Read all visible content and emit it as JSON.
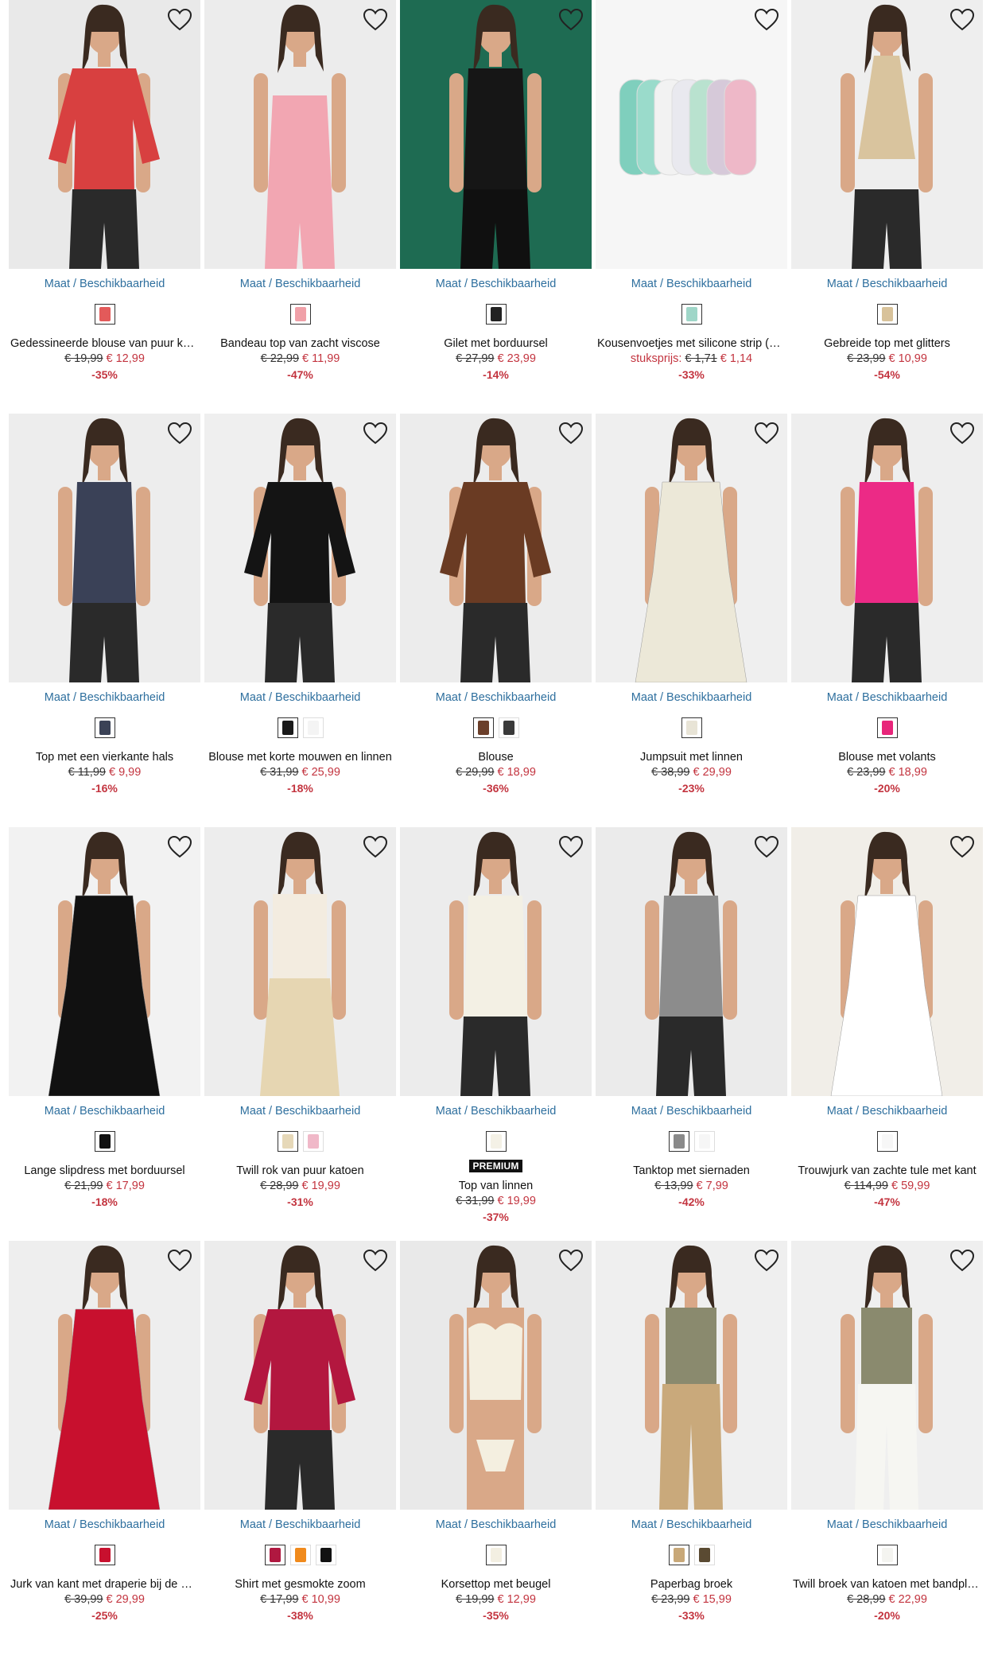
{
  "availability_label": "Maat / Beschikbaarheid",
  "wishlist_icon": "heart-outline-icon",
  "colors": {
    "price": "#c3343f",
    "link": "#2e6f9e"
  },
  "products": [
    {
      "title": "Gedessineerde blouse van puur kat…",
      "old_price": "€ 19,99",
      "new_price": "€ 12,99",
      "discount": "-35%",
      "swatches": [
        "#e35a5a"
      ],
      "image_bg": "#e9e9e9",
      "garment": "#d84040",
      "art": "blouse"
    },
    {
      "title": "Bandeau top van zacht viscose",
      "old_price": "€ 22,99",
      "new_price": "€ 11,99",
      "discount": "-47%",
      "swatches": [
        "#f0a0a8"
      ],
      "image_bg": "#ececec",
      "garment": "#f2a6b2",
      "art": "bandeau"
    },
    {
      "title": "Gilet met borduursel",
      "old_price": "€ 27,99",
      "new_price": "€ 23,99",
      "discount": "-14%",
      "swatches": [
        "#222222"
      ],
      "image_bg": "#1e6b52",
      "garment": "#161616",
      "art": "vest"
    },
    {
      "title": "Kousenvoetjes met silicone strip (7 …",
      "unit_label": "stuksprijs:",
      "old_price": "€ 1,71",
      "new_price": "€ 1,14",
      "discount": "-33%",
      "swatches": [
        "#9fd6c8"
      ],
      "image_bg": "#f6f6f6",
      "garment": "#7fcfbd",
      "art": "socks"
    },
    {
      "title": "Gebreide top met glitters",
      "old_price": "€ 23,99",
      "new_price": "€ 10,99",
      "discount": "-54%",
      "swatches": [
        "#d8c29a"
      ],
      "image_bg": "#eeeeee",
      "garment": "#d9c49e",
      "art": "halter"
    },
    {
      "title": "Top met een vierkante hals",
      "old_price": "€ 11,99",
      "new_price": "€ 9,99",
      "discount": "-16%",
      "swatches": [
        "#3b4256"
      ],
      "image_bg": "#ededed",
      "garment": "#3a4157",
      "art": "tank"
    },
    {
      "title": "Blouse met korte mouwen en linnen",
      "old_price": "€ 31,99",
      "new_price": "€ 25,99",
      "discount": "-18%",
      "swatches": [
        "#1a1a1a",
        "#f4f4f4"
      ],
      "image_bg": "#efefef",
      "garment": "#141414",
      "art": "blouse"
    },
    {
      "title": "Blouse",
      "old_price": "€ 29,99",
      "new_price": "€ 18,99",
      "discount": "-36%",
      "swatches": [
        "#6b3f2a",
        "#3a3a3a"
      ],
      "image_bg": "#ececec",
      "garment": "#6a3b23",
      "art": "blouse"
    },
    {
      "title": "Jumpsuit met linnen",
      "old_price": "€ 38,99",
      "new_price": "€ 29,99",
      "discount": "-23%",
      "swatches": [
        "#e8e4d6"
      ],
      "image_bg": "#efefef",
      "garment": "#ece8d8",
      "art": "dress"
    },
    {
      "title": "Blouse met volants",
      "old_price": "€ 23,99",
      "new_price": "€ 18,99",
      "discount": "-20%",
      "swatches": [
        "#e8257a"
      ],
      "image_bg": "#eeeeee",
      "garment": "#ec2a86",
      "art": "tank"
    },
    {
      "title": "Lange slipdress met borduursel",
      "old_price": "€ 21,99",
      "new_price": "€ 17,99",
      "discount": "-18%",
      "swatches": [
        "#111111"
      ],
      "image_bg": "#f2f2f2",
      "garment": "#111111",
      "art": "dress"
    },
    {
      "title": "Twill rok van puur katoen",
      "old_price": "€ 28,99",
      "new_price": "€ 19,99",
      "discount": "-31%",
      "swatches": [
        "#e6d8b8",
        "#f0b8c8"
      ],
      "image_bg": "#ededed",
      "garment": "#e6d6b2",
      "art": "skirt"
    },
    {
      "title": "Top van linnen",
      "badge": "PREMIUM",
      "old_price": "€ 31,99",
      "new_price": "€ 19,99",
      "discount": "-37%",
      "swatches": [
        "#f4f1e6"
      ],
      "image_bg": "#ececec",
      "garment": "#f3f0e4",
      "art": "tank"
    },
    {
      "title": "Tanktop met siernaden",
      "old_price": "€ 13,99",
      "new_price": "€ 7,99",
      "discount": "-42%",
      "swatches": [
        "#8a8a8a",
        "#f6f6f6"
      ],
      "image_bg": "#ebebeb",
      "garment": "#8c8c8c",
      "art": "tank"
    },
    {
      "title": "Trouwjurk van zachte tule met kant",
      "old_price": "€ 114,99",
      "new_price": "€ 59,99",
      "discount": "-47%",
      "swatches": [
        "#f7f7f7"
      ],
      "image_bg": "#f1eee8",
      "garment": "#ffffff",
      "art": "dress"
    },
    {
      "title": "Jurk van kant met draperie bij de m…",
      "old_price": "€ 39,99",
      "new_price": "€ 29,99",
      "discount": "-25%",
      "swatches": [
        "#c8102e"
      ],
      "image_bg": "#eeeeee",
      "garment": "#c8102e",
      "art": "dress"
    },
    {
      "title": "Shirt met gesmokte zoom",
      "old_price": "€ 17,99",
      "new_price": "€ 10,99",
      "discount": "-38%",
      "swatches": [
        "#b01840",
        "#f08a1c",
        "#111111"
      ],
      "image_bg": "#ececec",
      "garment": "#b3173f",
      "art": "blouse"
    },
    {
      "title": "Korsettop met beugel",
      "old_price": "€ 19,99",
      "new_price": "€ 12,99",
      "discount": "-35%",
      "swatches": [
        "#f3efe2"
      ],
      "image_bg": "#e9e9e9",
      "garment": "#f4efe0",
      "art": "corset"
    },
    {
      "title": "Paperbag broek",
      "old_price": "€ 23,99",
      "new_price": "€ 15,99",
      "discount": "-33%",
      "swatches": [
        "#c8a878",
        "#5a4a32"
      ],
      "image_bg": "#efefef",
      "garment": "#c9a97b",
      "art": "pants"
    },
    {
      "title": "Twill broek van katoen met bandplo…",
      "old_price": "€ 28,99",
      "new_price": "€ 22,99",
      "discount": "-20%",
      "swatches": [
        "#f4f4f0"
      ],
      "image_bg": "#efefef",
      "garment": "#f6f6f2",
      "art": "pants"
    }
  ]
}
